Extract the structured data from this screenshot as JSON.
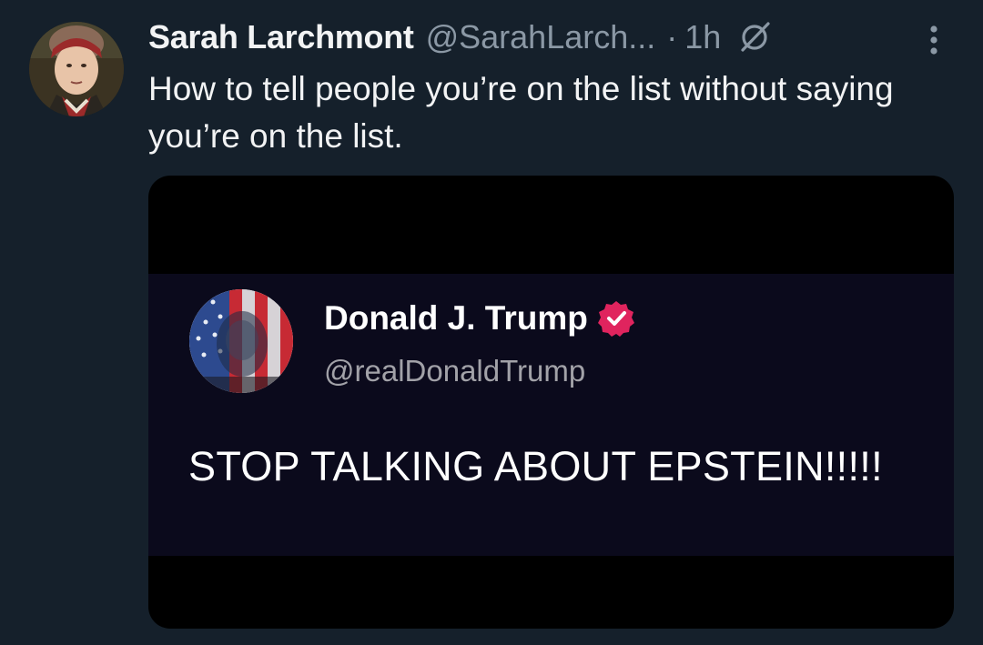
{
  "tweet": {
    "author_name": "Sarah Larchmont",
    "author_handle": "@SarahLarch...",
    "separator": "·",
    "time": "1h",
    "text": "How to tell people you’re on the list without saying you’re on the list."
  },
  "icons": {
    "avatar": "author-avatar-portrait",
    "grok": "grok-slash-icon",
    "more": "more-vertical-icon"
  },
  "embedded_post": {
    "name": "Donald J. Trump",
    "handle": "@realDonaldTrump",
    "text": "STOP TALKING ABOUT EPSTEIN!!!!!",
    "verified_icon": "verified-badge-icon",
    "verified_color": "#e0245e"
  },
  "colors": {
    "background": "#15202b",
    "secondary_text": "#8b98a5",
    "primary_text": "#e7e9ea",
    "media_background": "#000000",
    "embedded_background": "#0b0a1c"
  }
}
